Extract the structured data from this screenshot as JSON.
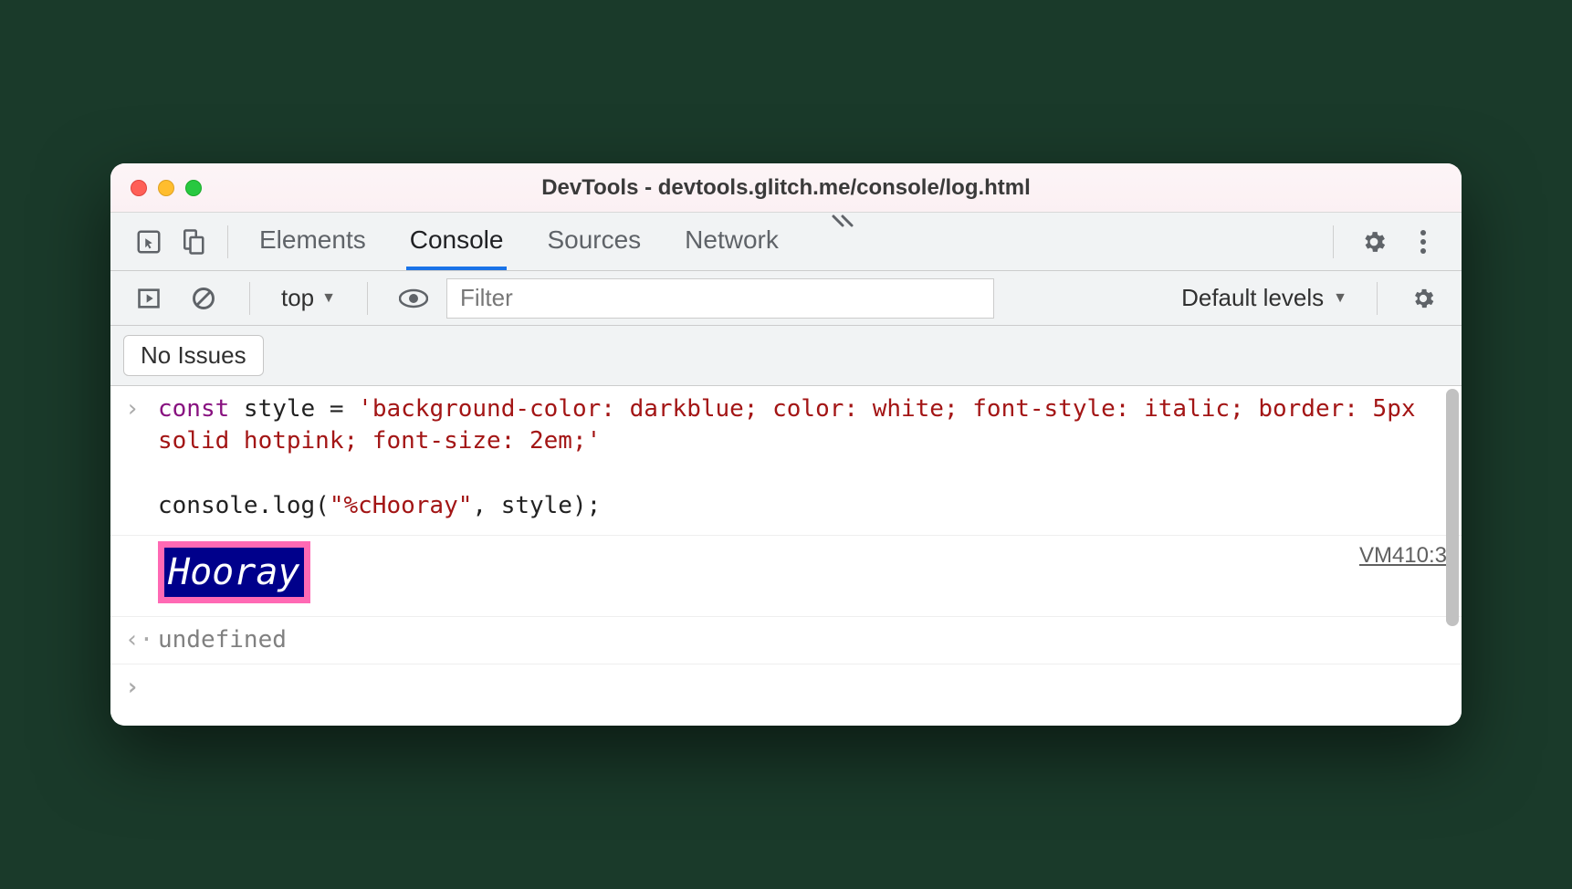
{
  "window": {
    "title": "DevTools - devtools.glitch.me/console/log.html"
  },
  "tabs": {
    "items": [
      "Elements",
      "Console",
      "Sources",
      "Network"
    ],
    "active": "Console"
  },
  "toolbar": {
    "context": "top",
    "filter_placeholder": "Filter",
    "levels": "Default levels"
  },
  "issues": {
    "label": "No Issues"
  },
  "console": {
    "input_code": {
      "line1_kw": "const",
      "line1_rest_a": " style = ",
      "line1_str": "'background-color: darkblue; color: white; font-style: italic; border: 5px solid hotpink; font-size: 2em;'",
      "line2": "console.log(",
      "line2_str": "\"%cHooray\"",
      "line2_end": ", style);"
    },
    "output": {
      "text": "Hooray",
      "source": "VM410:3"
    },
    "return": "undefined"
  }
}
